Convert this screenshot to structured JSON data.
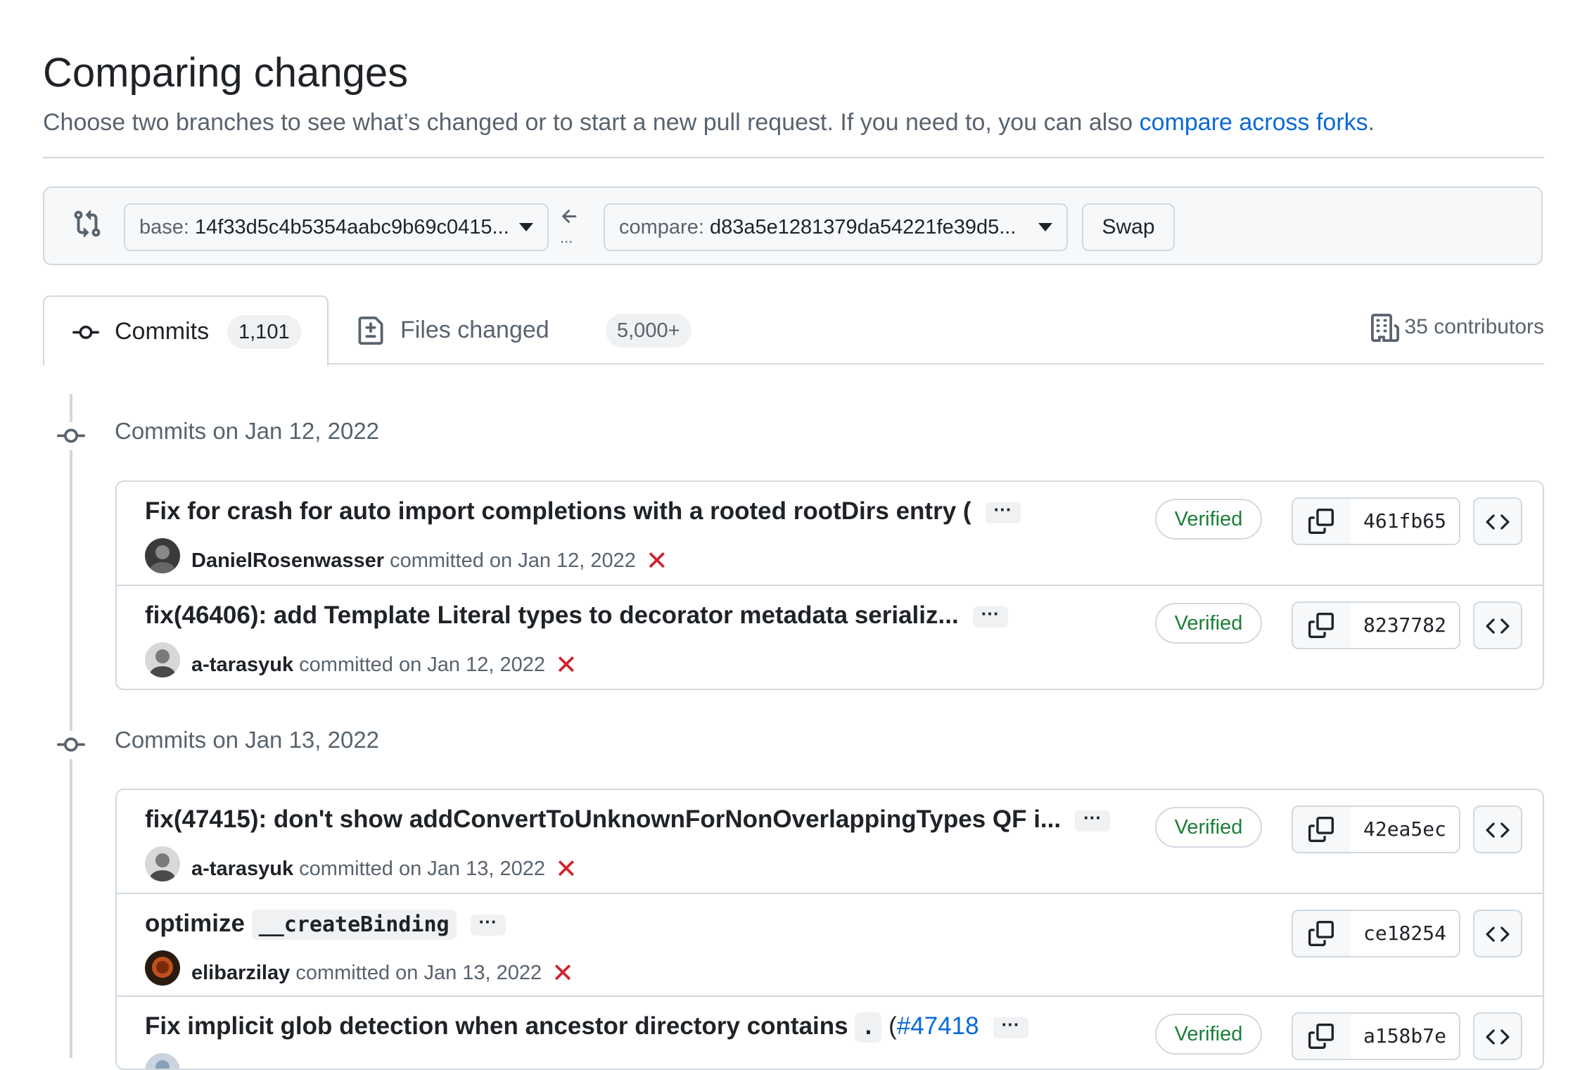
{
  "header": {
    "title": "Comparing changes",
    "subtitle_text": "Choose two branches to see what’s changed or to start a new pull request. If you need to, you can also ",
    "subtitle_link": "compare across forks",
    "subtitle_end": "."
  },
  "range": {
    "base_prefix": "base:",
    "base_value": "14f33d5c4b5354aabc9b69c0415...",
    "compare_prefix": "compare:",
    "compare_value": "d83a5e1281379da54221fe39d5...",
    "swap_label": "Swap",
    "dots": "..."
  },
  "tabs": {
    "commits_label": "Commits",
    "commits_count": "1,101",
    "files_label": "Files changed",
    "files_count": "5,000+",
    "contributors": "35 contributors"
  },
  "groups": [
    {
      "heading": "Commits on Jan 12, 2022",
      "commits": [
        {
          "message": "Fix for crash for auto import completions with a rooted rootDirs entry (",
          "author": "DanielRosenwasser",
          "committed": "committed on Jan 12, 2022",
          "verified": "Verified",
          "sha": "461fb65"
        },
        {
          "message": "fix(46406): add Template Literal types to decorator metadata serializ...",
          "author": "a-tarasyuk",
          "committed": "committed on Jan 12, 2022",
          "verified": "Verified",
          "sha": "8237782"
        }
      ]
    },
    {
      "heading": "Commits on Jan 13, 2022",
      "commits": [
        {
          "message": "fix(47415): don't show addConvertToUnknownForNonOverlappingTypes QF i...",
          "author": "a-tarasyuk",
          "committed": "committed on Jan 13, 2022",
          "verified": "Verified",
          "sha": "42ea5ec"
        },
        {
          "message_pre": "optimize",
          "message_code": "__createBinding",
          "author": "elibarzilay",
          "committed": "committed on Jan 13, 2022",
          "sha": "ce18254"
        },
        {
          "message_pre": "Fix implicit glob detection when ancestor directory contains",
          "message_code": ".",
          "message_paren": "(",
          "message_link": "#47418",
          "verified": "Verified",
          "sha": "a158b7e"
        }
      ]
    }
  ],
  "ellipsis": "···",
  "status_fail": "✕",
  "colors": {
    "accent": "#0969da",
    "verified": "#1a7f37",
    "fail": "#cf222e",
    "muted": "#59636e"
  }
}
